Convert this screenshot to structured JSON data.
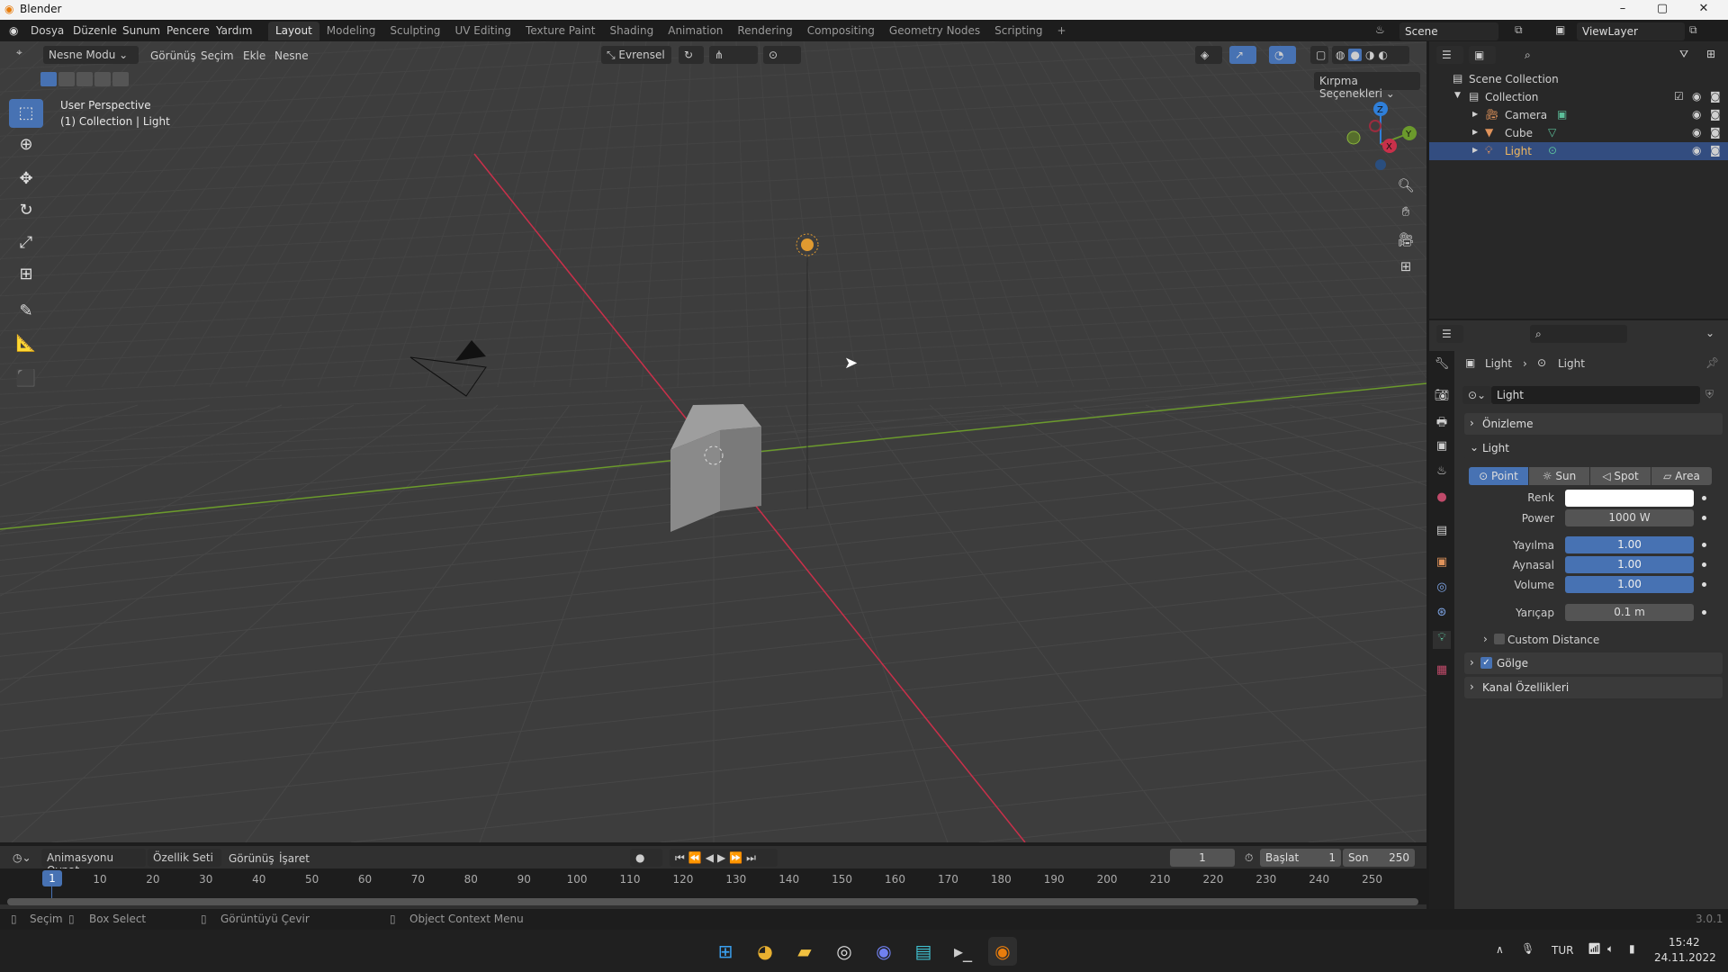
{
  "window": {
    "title": "Blender",
    "controls": [
      "–",
      "▢",
      "✕"
    ]
  },
  "menu": [
    "Dosya",
    "Düzenle",
    "Sunum",
    "Pencere",
    "Yardım"
  ],
  "workspaces": [
    {
      "label": "Layout",
      "active": true
    },
    {
      "label": "Modeling"
    },
    {
      "label": "Sculpting"
    },
    {
      "label": "UV Editing"
    },
    {
      "label": "Texture Paint"
    },
    {
      "label": "Shading"
    },
    {
      "label": "Animation"
    },
    {
      "label": "Rendering"
    },
    {
      "label": "Compositing"
    },
    {
      "label": "Geometry Nodes"
    },
    {
      "label": "Scripting"
    }
  ],
  "add_workspace": "+",
  "scene": {
    "name": "Scene",
    "view_layer": "ViewLayer"
  },
  "viewport": {
    "mode": "Nesne Modu",
    "menus": [
      "Görünüş",
      "Seçim",
      "Ekle",
      "Nesne"
    ],
    "orientation": "Evrensel",
    "clipping": "Kırpma Seçenekleri",
    "overlay_title": "User Perspective",
    "overlay_subtitle": "(1) Collection | Light",
    "gizmo": {
      "x": "X",
      "y": "Y",
      "z": "Z"
    },
    "colors": {
      "x_axis": "#c8304a",
      "y_axis": "#6b9a2c",
      "z_axis": "#2f7fd9",
      "active_tool": "#4772b3"
    }
  },
  "outliner": {
    "root": "Scene Collection",
    "collection": "Collection",
    "items": [
      {
        "label": "Camera",
        "selected": false
      },
      {
        "label": "Cube",
        "selected": false
      },
      {
        "label": "Light",
        "selected": true
      }
    ]
  },
  "properties": {
    "breadcrumb": [
      "Light",
      "Light"
    ],
    "datablock": "Light",
    "panels": {
      "preview": "Önizleme",
      "light": "Light",
      "shadow": "Gölge",
      "channels": "Kanal Özellikleri",
      "custom_distance": "Custom Distance"
    },
    "shadow_enabled": true,
    "custom_distance_enabled": false,
    "light_types": [
      {
        "label": "Point",
        "active": true
      },
      {
        "label": "Sun"
      },
      {
        "label": "Spot"
      },
      {
        "label": "Area"
      }
    ],
    "fields": [
      {
        "label": "Renk",
        "value": "",
        "color": "#ffffff"
      },
      {
        "label": "Power",
        "value": "1000 W"
      },
      {
        "label": "Yayılma",
        "value": "1.00"
      },
      {
        "label": "Aynasal",
        "value": "1.00"
      },
      {
        "label": "Volume",
        "value": "1.00"
      },
      {
        "label": "Yarıçap",
        "value": "0.1 m"
      }
    ]
  },
  "timeline": {
    "menus": [
      "Animasyonu Oynat",
      "Özellik Seti",
      "Görünüş",
      "İşaret"
    ],
    "current_frame": "1",
    "start_label": "Başlat",
    "start": "1",
    "end_label": "Son",
    "end": "250",
    "ticks": [
      "10",
      "20",
      "30",
      "40",
      "50",
      "60",
      "70",
      "80",
      "90",
      "100",
      "110",
      "120",
      "130",
      "140",
      "150",
      "160",
      "170",
      "180",
      "190",
      "200",
      "210",
      "220",
      "230",
      "240",
      "250"
    ]
  },
  "statusbar": {
    "items": [
      "Seçim",
      "Box Select",
      "Görüntüyü Çevir",
      "Object Context Menu"
    ],
    "version": "3.0.1"
  },
  "taskbar": {
    "language": "TUR",
    "time": "15:42",
    "date": "24.11.2022"
  }
}
